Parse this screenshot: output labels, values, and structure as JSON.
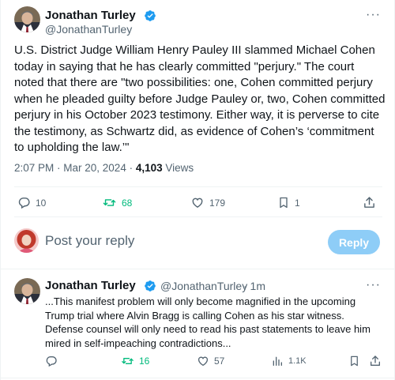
{
  "main_tweet": {
    "author_name": "Jonathan Turley",
    "author_handle": "@JonathanTurley",
    "more_label": "···",
    "text": "U.S. District Judge William Henry Pauley III slammed Michael Cohen today in saying that he has clearly committed \"perjury.\" The court noted that there are \"two possibilities: one, Cohen committed perjury when he pleaded guilty before Judge Pauley or, two, Cohen committed perjury in his October 2023 testimony. Either way, it is perverse to cite the testimony, as Schwartz did, as evidence of Cohen’s ‘commitment to upholding the law.’\"",
    "timestamp": "2:07 PM · Mar 20, 2024 · ",
    "views_count": "4,103",
    "views_label": " Views",
    "actions": {
      "replies": "10",
      "retweets": "68",
      "likes": "179",
      "bookmarks": "1"
    }
  },
  "composer": {
    "placeholder": "Post your reply",
    "button_label": "Reply"
  },
  "reply_tweet": {
    "author_name": "Jonathan Turley",
    "author_handle": "@JonathanTurley",
    "time": "· 1m",
    "more_label": "···",
    "text": "...This manifest problem will only become magnified in the upcoming Trump trial where Alvin Bragg is calling Cohen as his star witness. Defense counsel will only need to read his past statements to leave him mired in self-impeaching contradictions...",
    "actions": {
      "retweets": "16",
      "likes": "57",
      "views": "1.1K"
    }
  },
  "colors": {
    "accent": "#1d9bf0",
    "retweet_green": "#00ba7c",
    "muted": "#536471",
    "reply_button_disabled": "#8ecdf7"
  }
}
